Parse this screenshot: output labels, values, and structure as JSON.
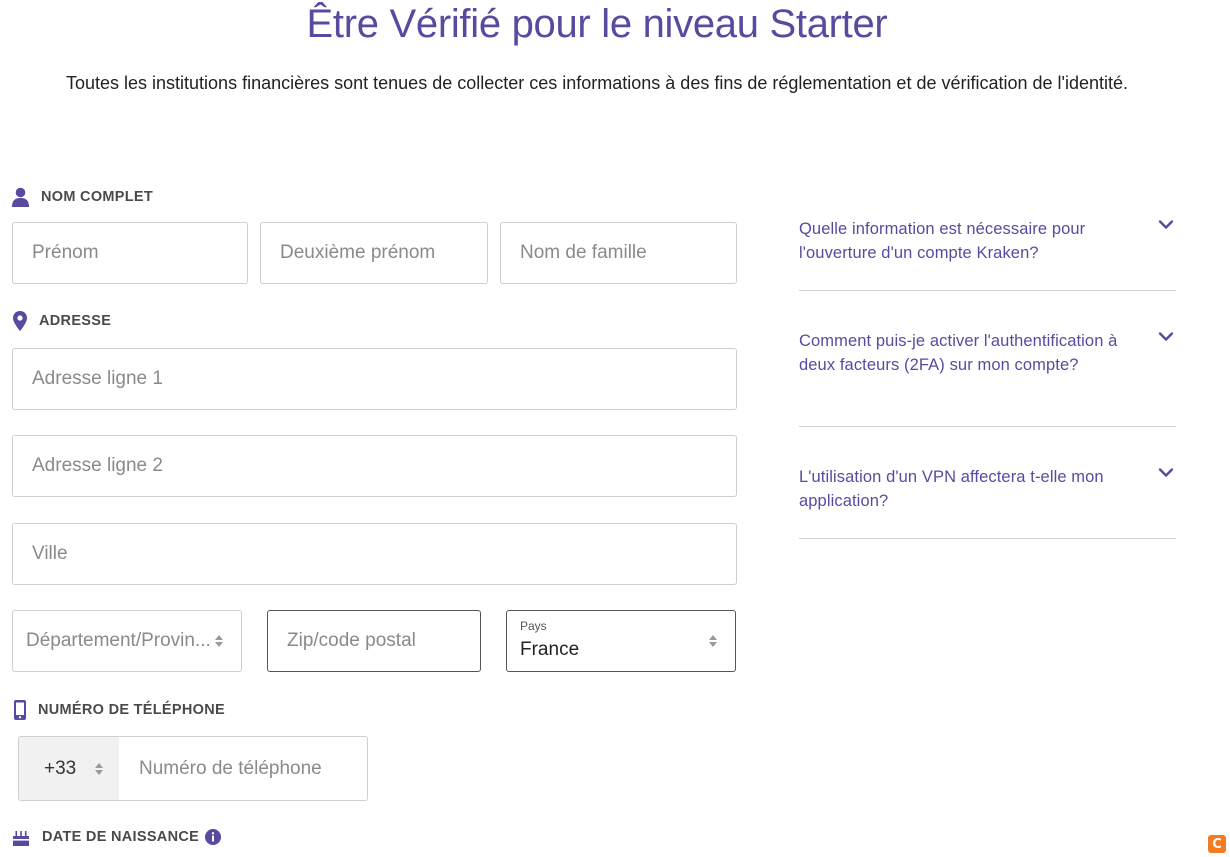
{
  "page": {
    "title": "Être Vérifié pour le niveau Starter",
    "subtitle": "Toutes les institutions financières sont tenues de collecter ces informations à des fins de réglementation et de vérification de l'identité."
  },
  "sections": {
    "name": {
      "label": "NOM COMPLET",
      "icon": "user-icon"
    },
    "address": {
      "label": "ADRESSE",
      "icon": "map-pin-icon"
    },
    "phone": {
      "label": "NUMÉRO DE TÉLÉPHONE",
      "icon": "mobile-phone-icon"
    },
    "birth": {
      "label": "DATE DE NAISSANCE",
      "icon": "birthday-cake-icon",
      "info_icon": "info-icon"
    }
  },
  "fields": {
    "first_name": {
      "placeholder": "Prénom",
      "value": ""
    },
    "middle_name": {
      "placeholder": "Deuxième prénom",
      "value": ""
    },
    "last_name": {
      "placeholder": "Nom de famille",
      "value": ""
    },
    "address_line1": {
      "placeholder": "Adresse ligne 1",
      "value": ""
    },
    "address_line2": {
      "placeholder": "Adresse ligne 2",
      "value": ""
    },
    "city": {
      "placeholder": "Ville",
      "value": ""
    },
    "state": {
      "placeholder": "Département/Provin...",
      "value": ""
    },
    "zip": {
      "placeholder": "Zip/code postal",
      "value": ""
    },
    "country": {
      "label": "Pays",
      "value": "France"
    },
    "phone_code": {
      "value": "+33"
    },
    "phone_number": {
      "placeholder": "Numéro de téléphone",
      "value": ""
    }
  },
  "faq": [
    {
      "question": "Quelle information est nécessaire pour l'ouverture d'un compte Kraken?"
    },
    {
      "question": "Comment puis-je activer l'authentification à deux facteurs (2FA) sur mon compte?"
    },
    {
      "question": "L'utilisation d'un VPN affectera t-elle mon application?"
    }
  ],
  "colors": {
    "brand": "#5a4a9f",
    "border": "#cfcfcf",
    "corner_badge": "#f47b20"
  },
  "corner_badge": {
    "icon": "extension-badge-icon",
    "glyph": "C"
  }
}
